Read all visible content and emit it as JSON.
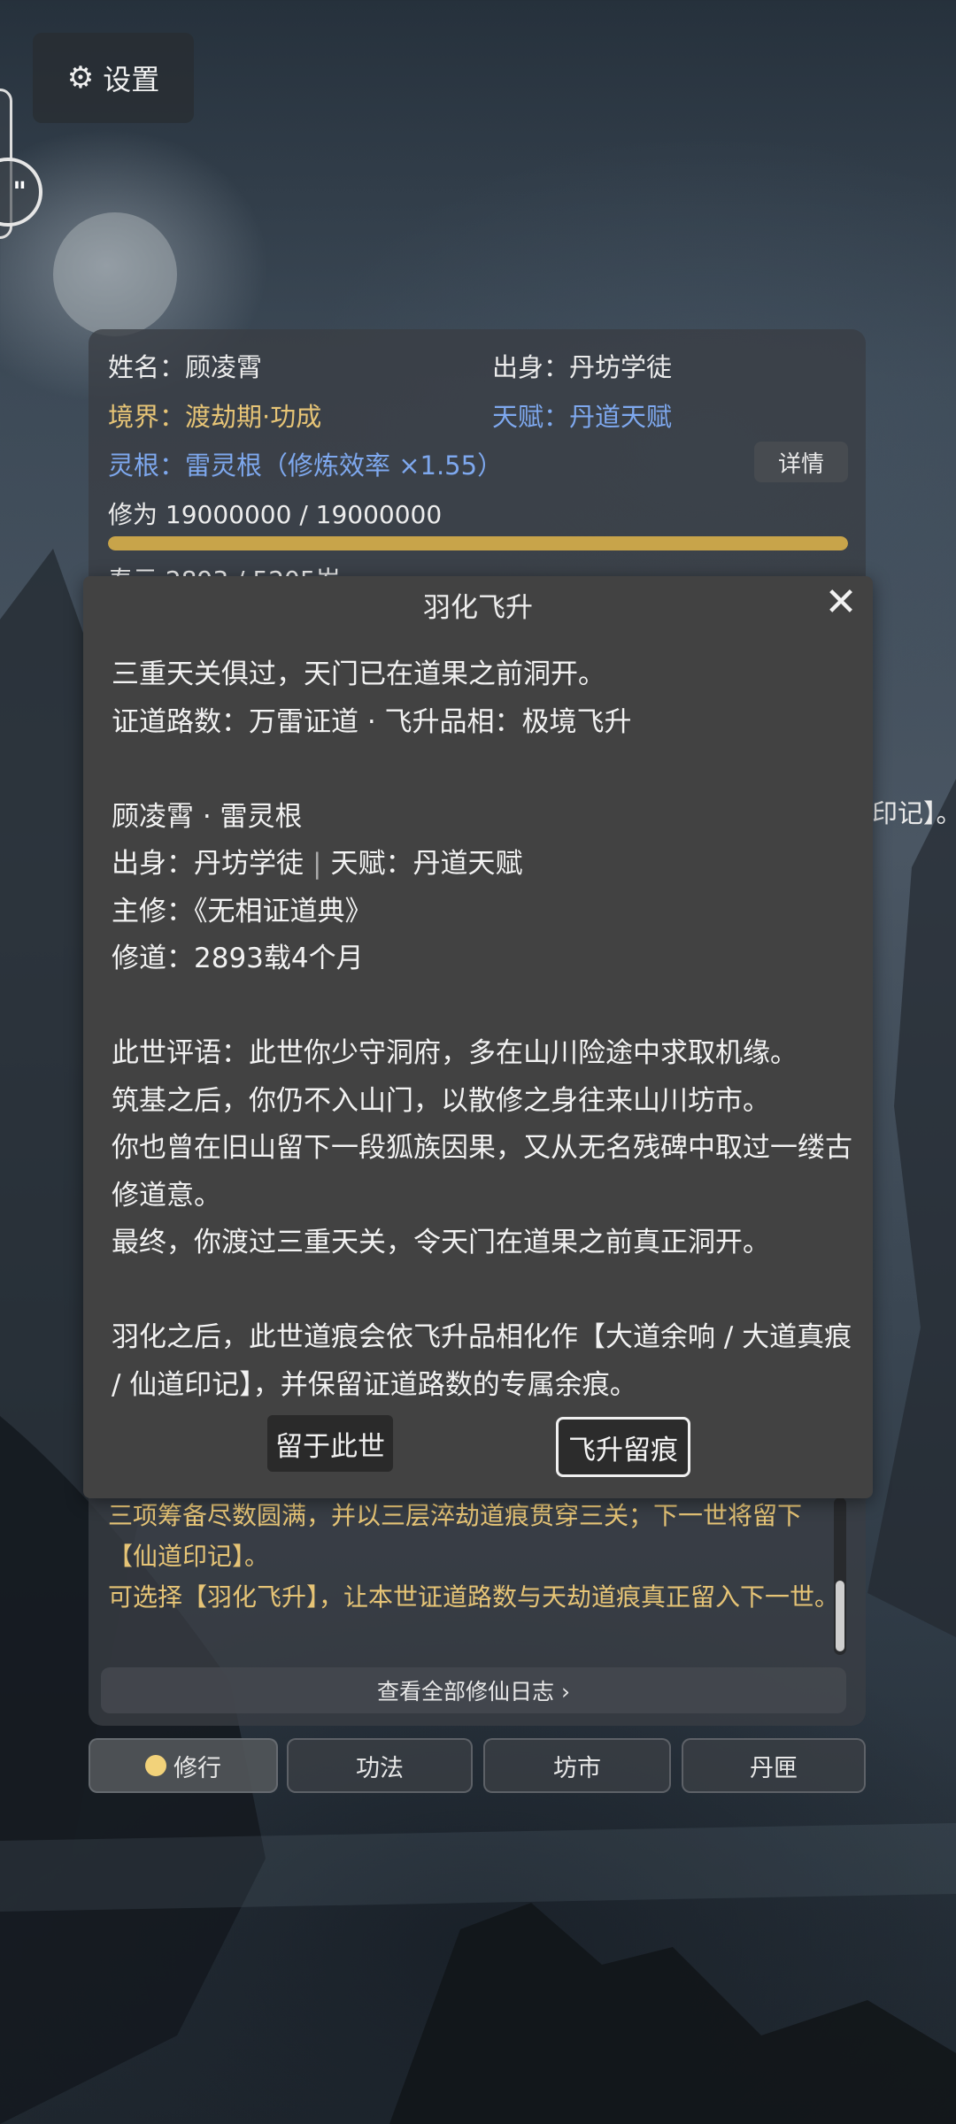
{
  "settings": {
    "icon": "gear-icon",
    "label": "设置"
  },
  "profile": {
    "name_label": "姓名：顾凌霄",
    "origin_label": "出身：丹坊学徒",
    "realm_label": "境界：渡劫期·功成",
    "talent_label": "天赋：丹道天赋",
    "root_label": "灵根：雷灵根（修炼效率 ×1.55）",
    "detail_button": "详情",
    "cultivation_label": "修为 19000000 / 19000000",
    "cultivation_progress": 1.0,
    "lifespan_label": "寿元 2893 / 5205岁"
  },
  "right_snippet": "印记】。",
  "modal": {
    "title": "羽化飞升",
    "close_icon": "close-icon",
    "line1": "三重天关俱过，天门已在道果之前洞开。",
    "line2": "证道路数：万雷证道 · 飞升品相：极境飞升",
    "line3": "顾凌霄 · 雷灵根",
    "origin": "出身：丹坊学徒",
    "separator": "|",
    "talent": "天赋：丹道天赋",
    "line5": "主修：《无相证道典》",
    "line6": "修道：2893载4个月",
    "para1": "此世评语：此世你少守洞府，多在山川险途中求取机缘。",
    "para2": "筑基之后，你仍不入山门，以散修之身往来山川坊市。",
    "para3": "你也曾在旧山留下一段狐族因果，又从无名残碑中取过一缕古修道意。",
    "para4": "最终，你渡过三重天关，令天门在道果之前真正洞开。",
    "para5": "羽化之后，此世道痕会依飞升品相化作【大道余响 / 大道真痕 / 仙道印记】，并保留证道路数的专属余痕。",
    "stay_button": "留于此世",
    "ascend_button": "飞升留痕"
  },
  "log": {
    "entry1": "三项筹备尽数圆满，并以三层淬劫道痕贯穿三关；下一世将留下【仙道印记】。",
    "entry2": "可选择【羽化飞升】，让本世证道路数与天劫道痕真正留入下一世。",
    "view_all": "查看全部修仙日志 ›"
  },
  "nav": {
    "tabs": [
      "修行",
      "功法",
      "坊市",
      "丹匣"
    ],
    "active_index": 0
  },
  "colors": {
    "gold": "#e6c476",
    "blue": "#7ea8ee",
    "modal_bg": "#424242",
    "progress": "#c8a44a"
  }
}
